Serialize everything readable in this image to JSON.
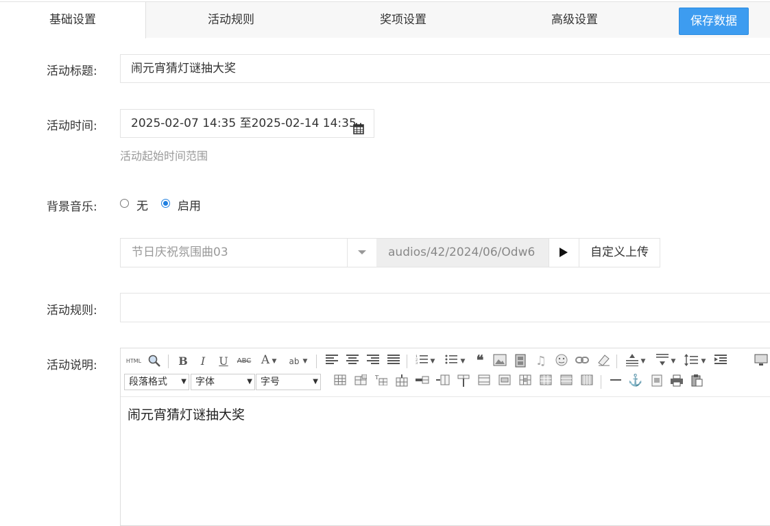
{
  "tabs": [
    {
      "label": "基础设置",
      "active": true
    },
    {
      "label": "活动规则",
      "active": false
    },
    {
      "label": "奖项设置",
      "active": false
    },
    {
      "label": "高级设置",
      "active": false
    }
  ],
  "save_label": "保存数据",
  "form": {
    "title_label": "活动标题:",
    "title_value": "闹元宵猜灯谜抽大奖",
    "time_label": "活动时间:",
    "time_value": "2025-02-07 14:35 至2025-02-14 14:35",
    "time_help": "活动起始时间范围",
    "music_label": "背景音乐:",
    "music_none": "无",
    "music_enable": "启用",
    "music_selected": "节日庆祝氛围曲03",
    "music_path": "audios/42/2024/06/Odw6",
    "upload_label": "自定义上传",
    "rules_label": "活动规则:",
    "desc_label": "活动说明:"
  },
  "editor": {
    "paragraph_select": "段落格式",
    "font_select": "字体",
    "size_select": "字号",
    "content": "闹元宵猜灯谜抽大奖"
  },
  "colors": {
    "accent": "#3d9cf0",
    "radio_checked": "#1f7fe0"
  }
}
